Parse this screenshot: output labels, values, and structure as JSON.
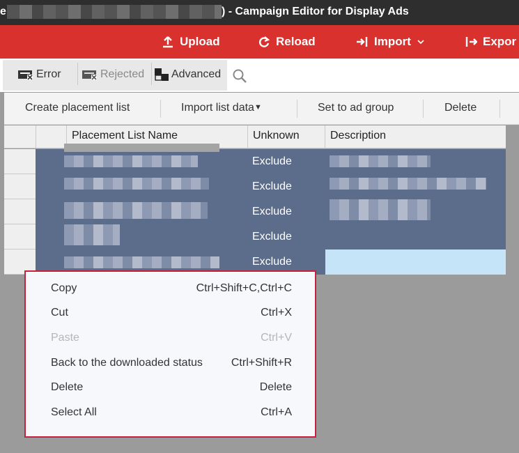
{
  "window": {
    "title": ") - Campaign Editor for Display Ads",
    "title_prefix": "e"
  },
  "toolbar": {
    "upload": "Upload",
    "reload": "Reload",
    "import": "Import",
    "export": "Expor"
  },
  "filters": {
    "error": "Error",
    "rejected": "Rejected",
    "advanced": "Advanced"
  },
  "actions": {
    "create": "Create placement list",
    "import_list": "Import list data",
    "set_group": "Set to ad group",
    "delete": "Delete"
  },
  "grid": {
    "columns": [
      "Placement List Name",
      "Unknown",
      "Description"
    ],
    "rows": [
      {
        "unknown": "Exclude"
      },
      {
        "unknown": "Exclude"
      },
      {
        "unknown": "Exclude"
      },
      {
        "unknown": "Exclude"
      },
      {
        "unknown": "Exclude"
      }
    ]
  },
  "context_menu": {
    "items": [
      {
        "label": "Copy",
        "shortcut": "Ctrl+Shift+C,Ctrl+C",
        "enabled": true
      },
      {
        "label": "Cut",
        "shortcut": "Ctrl+X",
        "enabled": true
      },
      {
        "label": "Paste",
        "shortcut": "Ctrl+V",
        "enabled": false
      },
      {
        "label": "Back to the downloaded status",
        "shortcut": "Ctrl+Shift+R",
        "enabled": true
      },
      {
        "label": "Delete",
        "shortcut": "Delete",
        "enabled": true
      },
      {
        "label": "Select All",
        "shortcut": "Ctrl+A",
        "enabled": true
      }
    ]
  },
  "colors": {
    "toolbar": "#d9322e",
    "selection": "#5c6d8b",
    "menu_border": "#c8203a"
  }
}
